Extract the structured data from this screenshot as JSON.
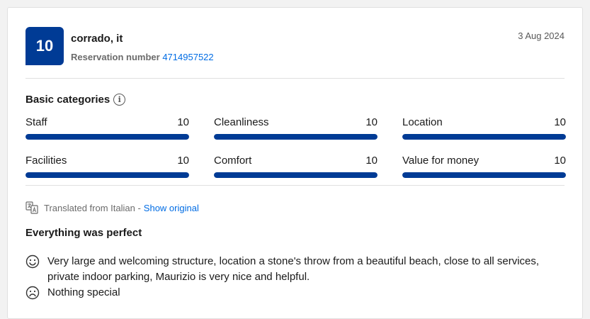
{
  "review": {
    "score": "10",
    "reviewer": "corrado, it",
    "reservation_label": "Reservation number",
    "reservation_number": "4714957522",
    "date": "3 Aug 2024"
  },
  "categories": {
    "title": "Basic categories",
    "info_icon": "i",
    "items": [
      {
        "label": "Staff",
        "score": "10",
        "fraction": 1.0
      },
      {
        "label": "Cleanliness",
        "score": "10",
        "fraction": 1.0
      },
      {
        "label": "Location",
        "score": "10",
        "fraction": 1.0
      },
      {
        "label": "Facilities",
        "score": "10",
        "fraction": 1.0
      },
      {
        "label": "Comfort",
        "score": "10",
        "fraction": 1.0
      },
      {
        "label": "Value for money",
        "score": "10",
        "fraction": 1.0
      }
    ],
    "bar_color": "#003b95"
  },
  "translation": {
    "text": "Translated from Italian -",
    "link": "Show original",
    "icon": "translate-icon"
  },
  "content": {
    "title": "Everything was perfect",
    "positive": "Very large and welcoming structure, location a stone's throw from a beautiful beach, close to all services, private indoor parking, Maurizio is very nice and helpful.",
    "negative": "Nothing special",
    "positive_icon": "smile-face-icon",
    "negative_icon": "sad-face-icon"
  },
  "colors": {
    "brand": "#003b95",
    "link": "#006ce4"
  }
}
